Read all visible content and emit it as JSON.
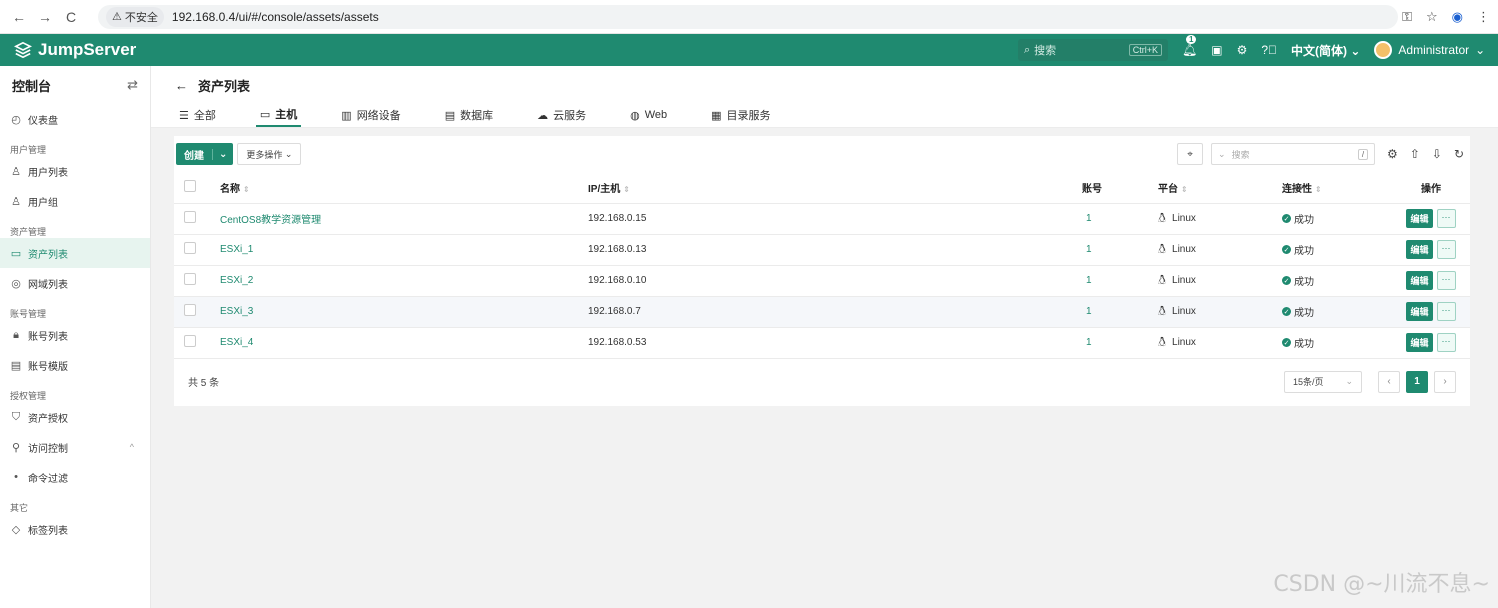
{
  "browser": {
    "back": "←",
    "forward": "→",
    "reload": "C",
    "secure_label": "不安全",
    "url": "192.168.0.4/ui/#/console/assets/assets"
  },
  "topbar": {
    "brand": "JumpServer",
    "search_placeholder": "搜索",
    "search_shortcut": "Ctrl+K",
    "notification_count": "1",
    "language": "中文(简体)",
    "user": "Administrator"
  },
  "sidebar": {
    "title": "控制台",
    "sections": [
      {
        "group": "",
        "items": [
          {
            "label": "仪表盘",
            "icon": "dashboard-icon"
          }
        ]
      },
      {
        "group": "用户管理",
        "items": [
          {
            "label": "用户列表",
            "icon": "user-icon"
          },
          {
            "label": "用户组",
            "icon": "user-group-icon"
          }
        ]
      },
      {
        "group": "资产管理",
        "items": [
          {
            "label": "资产列表",
            "icon": "asset-icon",
            "active": true
          },
          {
            "label": "网域列表",
            "icon": "domain-icon"
          }
        ]
      },
      {
        "group": "账号管理",
        "items": [
          {
            "label": "账号列表",
            "icon": "lock-icon"
          },
          {
            "label": "账号模版",
            "icon": "template-icon"
          }
        ]
      },
      {
        "group": "授权管理",
        "items": [
          {
            "label": "资产授权",
            "icon": "shield-icon"
          },
          {
            "label": "访问控制",
            "icon": "access-icon"
          },
          {
            "label": "命令过滤",
            "icon": "dot-icon"
          }
        ]
      },
      {
        "group": "其它",
        "items": [
          {
            "label": "标签列表",
            "icon": "tag-icon"
          }
        ]
      }
    ]
  },
  "page": {
    "title": "资产列表",
    "tabs": [
      "全部",
      "主机",
      "网络设备",
      "数据库",
      "云服务",
      "Web",
      "目录服务"
    ],
    "active_tab": "主机"
  },
  "toolbar": {
    "create": "创建",
    "more": "更多操作",
    "search_placeholder": "搜索",
    "search_shortcut": "/"
  },
  "table": {
    "columns": {
      "name": "名称",
      "ip": "IP/主机",
      "accounts": "账号",
      "platform": "平台",
      "connectivity": "连接性",
      "actions": "操作"
    },
    "rows": [
      {
        "name": "CentOS8教学资源管理",
        "ip": "192.168.0.15",
        "accounts": "1",
        "platform": "Linux",
        "status": "成功"
      },
      {
        "name": "ESXi_1",
        "ip": "192.168.0.13",
        "accounts": "1",
        "platform": "Linux",
        "status": "成功"
      },
      {
        "name": "ESXi_2",
        "ip": "192.168.0.10",
        "accounts": "1",
        "platform": "Linux",
        "status": "成功"
      },
      {
        "name": "ESXi_3",
        "ip": "192.168.0.7",
        "accounts": "1",
        "platform": "Linux",
        "status": "成功"
      },
      {
        "name": "ESXi_4",
        "ip": "192.168.0.53",
        "accounts": "1",
        "platform": "Linux",
        "status": "成功"
      }
    ],
    "edit_label": "编辑",
    "more_label": "···"
  },
  "footer": {
    "total": "共 5 条",
    "page_size": "15条/页",
    "current_page": "1"
  },
  "watermark": "CSDN @~川流不息~",
  "colors": {
    "brand": "#1f8a70"
  }
}
